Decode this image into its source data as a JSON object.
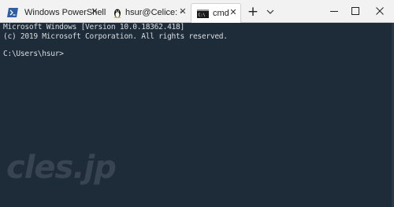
{
  "tabs": [
    {
      "label": "Windows PowerShell",
      "icon": "powershell-icon",
      "active": false
    },
    {
      "label": "hsur@Celice: ~",
      "icon": "linux-penguin-icon",
      "active": false
    },
    {
      "label": "cmd",
      "icon": "cmd-icon",
      "active": true
    }
  ],
  "controls": {
    "new_tab": "+",
    "close_glyph": "✕"
  },
  "terminal": {
    "lines": [
      "Microsoft Windows [Version 10.0.18362.418]",
      "(c) 2019 Microsoft Corporation. All rights reserved.",
      "",
      "C:\\Users\\hsur>"
    ]
  },
  "watermark": "cles.jp",
  "colors": {
    "terminal_background": "#1e2b38",
    "terminal_foreground": "#d8dde2",
    "titlebar_background": "#f2f2f2",
    "powershell_blue": "#2d5fa4"
  }
}
